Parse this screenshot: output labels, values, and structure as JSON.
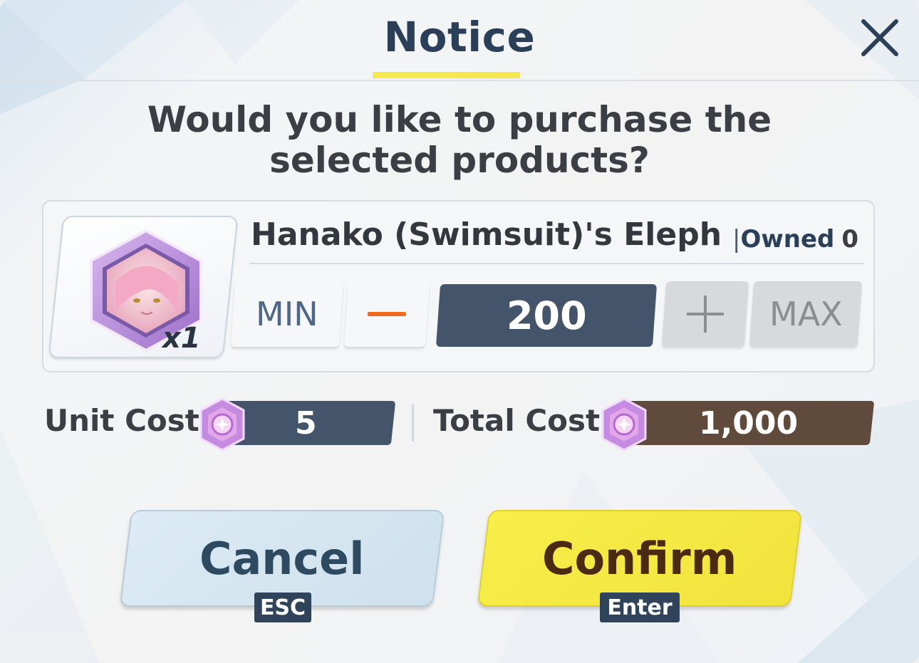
{
  "dialog": {
    "title": "Notice",
    "close_icon": "close-icon",
    "question": "Would you like to purchase the selected products?"
  },
  "item": {
    "name": "Hanako (Swimsuit)'s Eleph",
    "quantity_badge": "x1",
    "owned_separator": "|",
    "owned_label": "Owned",
    "owned_value": "0",
    "icon": "character-eleph-icon"
  },
  "stepper": {
    "min_label": "MIN",
    "minus_icon": "minus-icon",
    "value": "200",
    "plus_icon": "plus-icon",
    "max_label": "MAX"
  },
  "costs": {
    "unit_label": "Unit Cost",
    "unit_value": "5",
    "total_label": "Total Cost",
    "total_value": "1,000",
    "currency_icon": "gem-icon"
  },
  "actions": {
    "cancel_label": "Cancel",
    "cancel_key": "ESC",
    "confirm_label": "Confirm",
    "confirm_key": "Enter"
  },
  "colors": {
    "title_underline": "#f5e84c",
    "unit_bar": "#44546a",
    "total_bar": "#5f4a3b",
    "confirm": "#f3e640",
    "cancel": "#d6e7f2",
    "minus": "#f26a1d"
  }
}
